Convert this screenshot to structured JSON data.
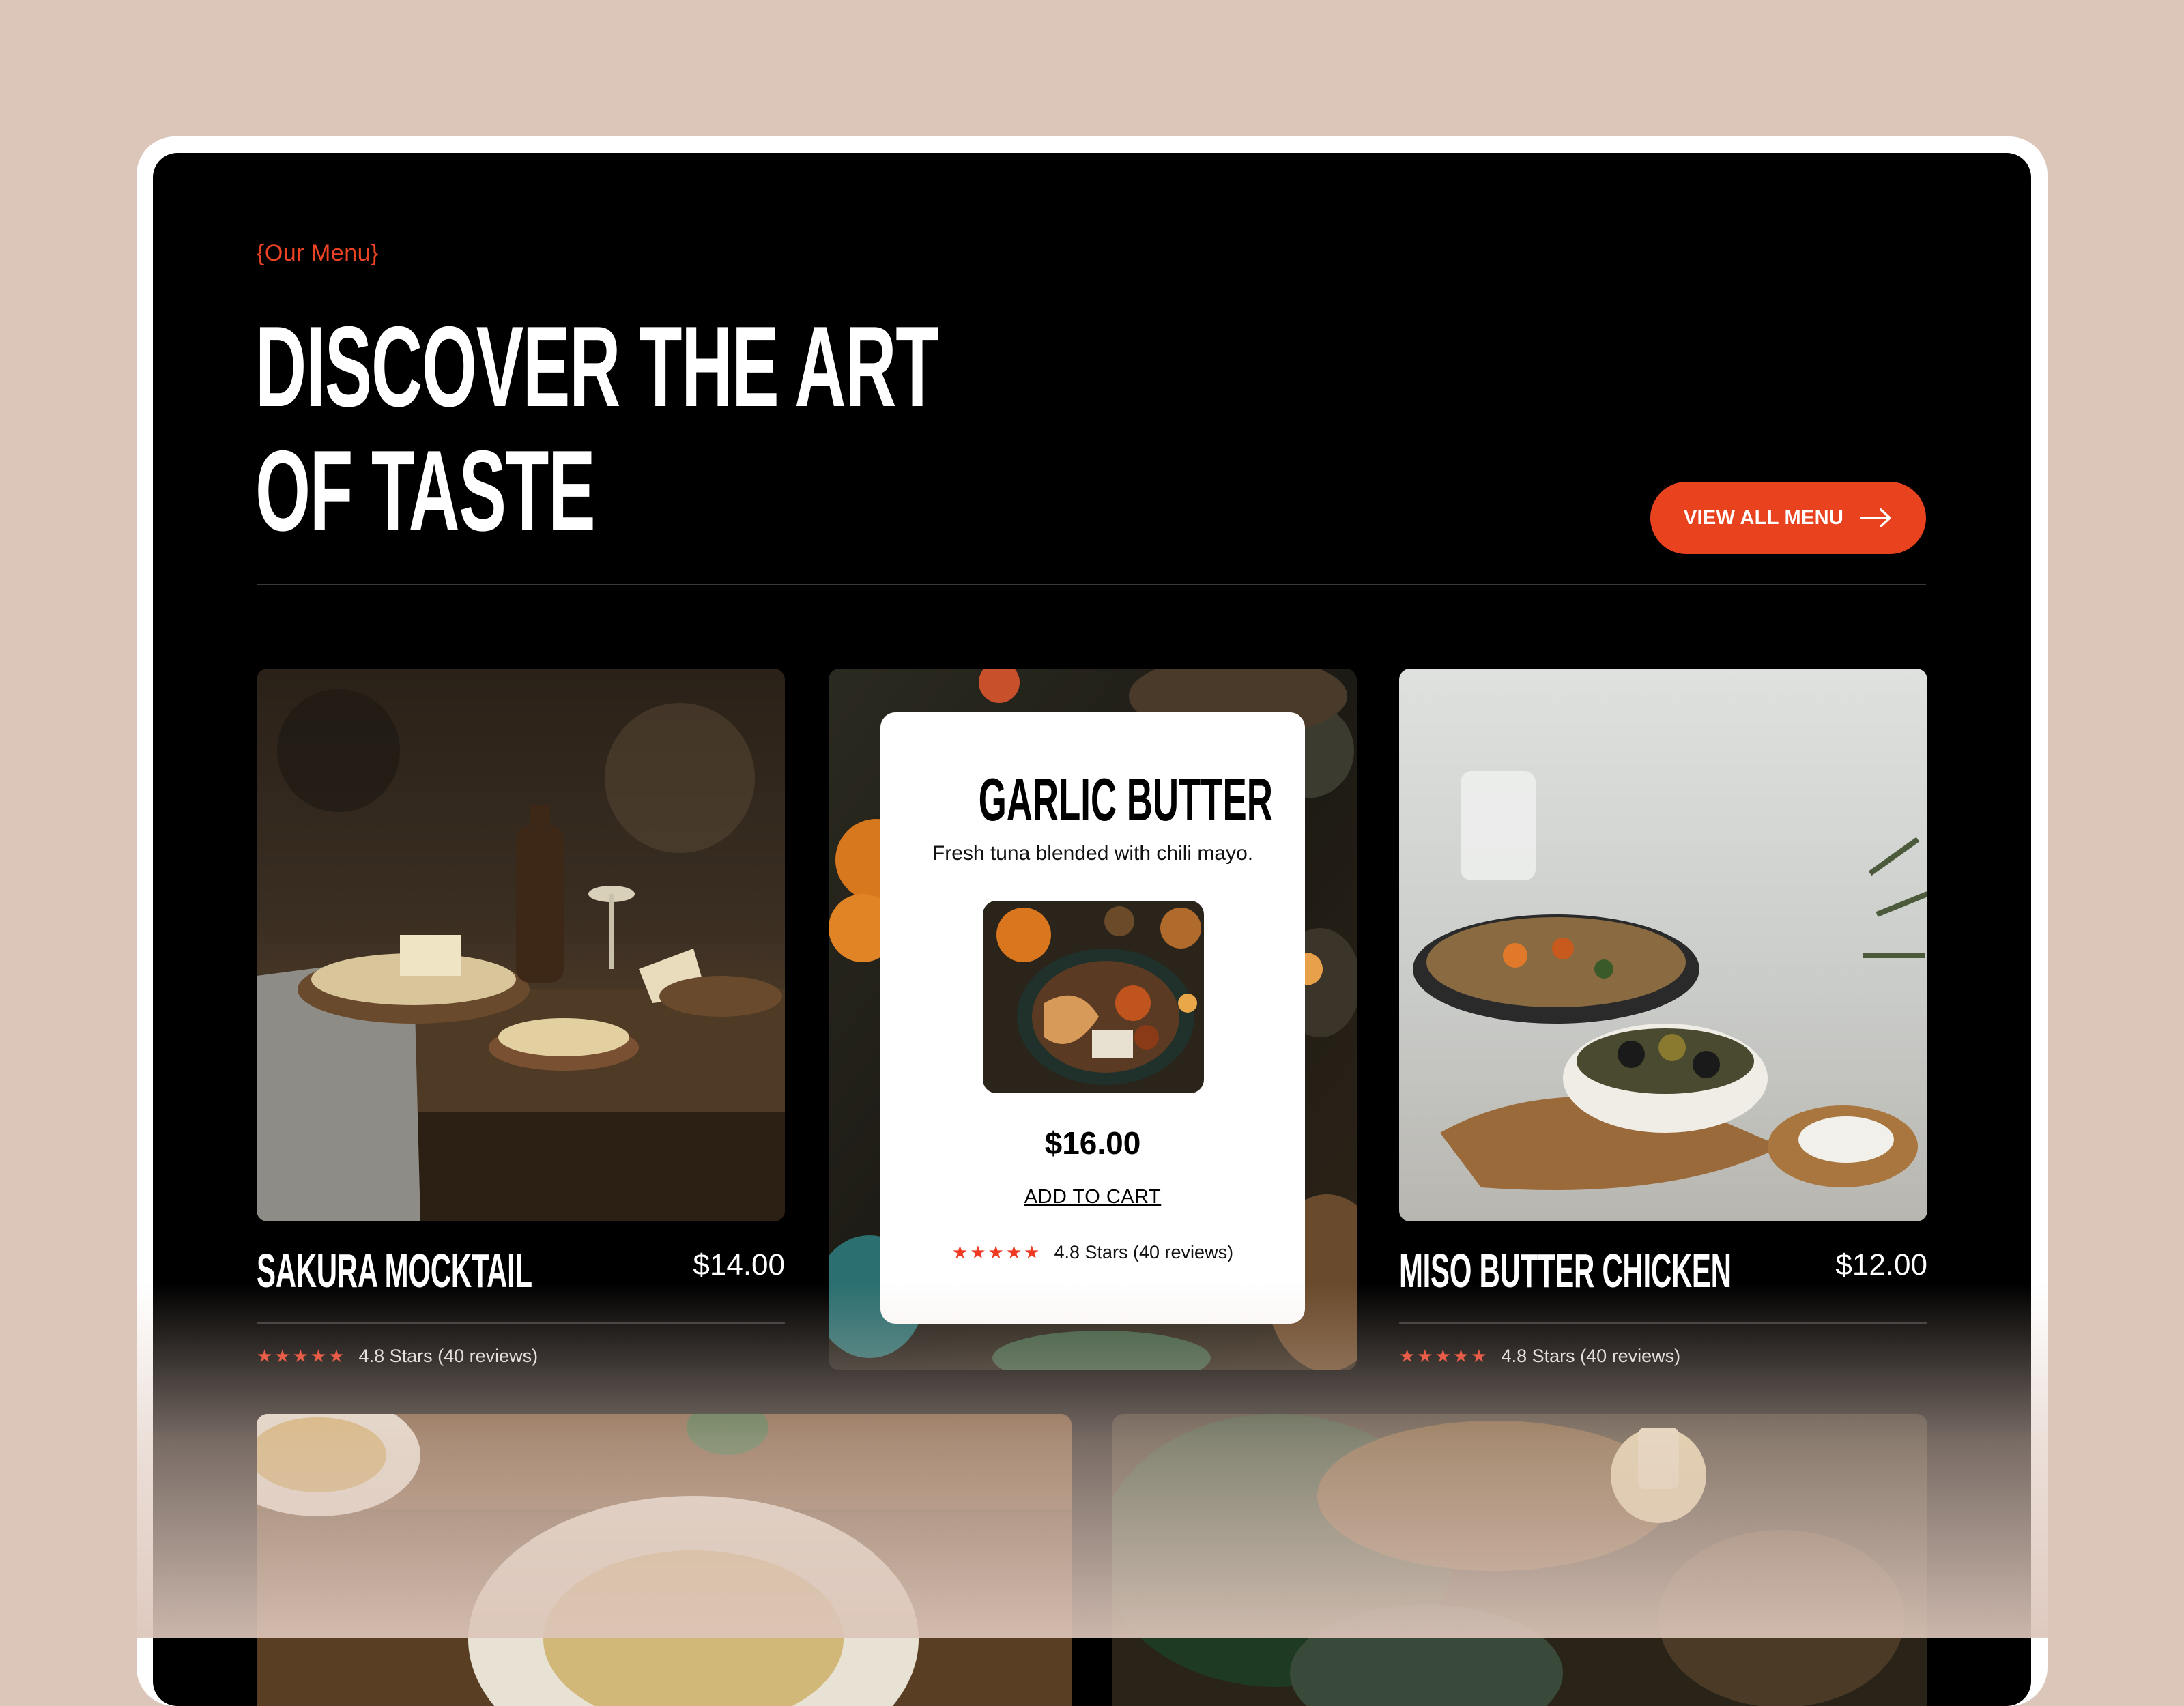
{
  "section": {
    "eyebrow": "{Our Menu}",
    "title_line1": "DISCOVER THE ART",
    "title_line2": "OF TASTE",
    "cta_label": "VIEW ALL MENU"
  },
  "colors": {
    "accent": "#e8421f",
    "background": "#000000",
    "page": "#dcc5b9",
    "star": "#ee3a22"
  },
  "cards": [
    {
      "name": "SAKURA MOCKTAIL",
      "price": "$14.00",
      "rating_text": "4.8 Stars (40 reviews)",
      "stars": 5
    },
    {
      "name": "MISO BUTTER CHICKEN",
      "price": "$12.00",
      "rating_text": "4.8 Stars (40 reviews)",
      "stars": 5
    }
  ],
  "featured": {
    "name": "GARLIC BUTTER",
    "description": "Fresh tuna blended with chili mayo.",
    "price": "$16.00",
    "cta_label": "ADD TO CART",
    "rating_text": "4.8 Stars (40 reviews)",
    "stars": 5
  },
  "icons": {
    "cta_icon": "arrow-right-icon",
    "rating_icon": "star-icon"
  }
}
